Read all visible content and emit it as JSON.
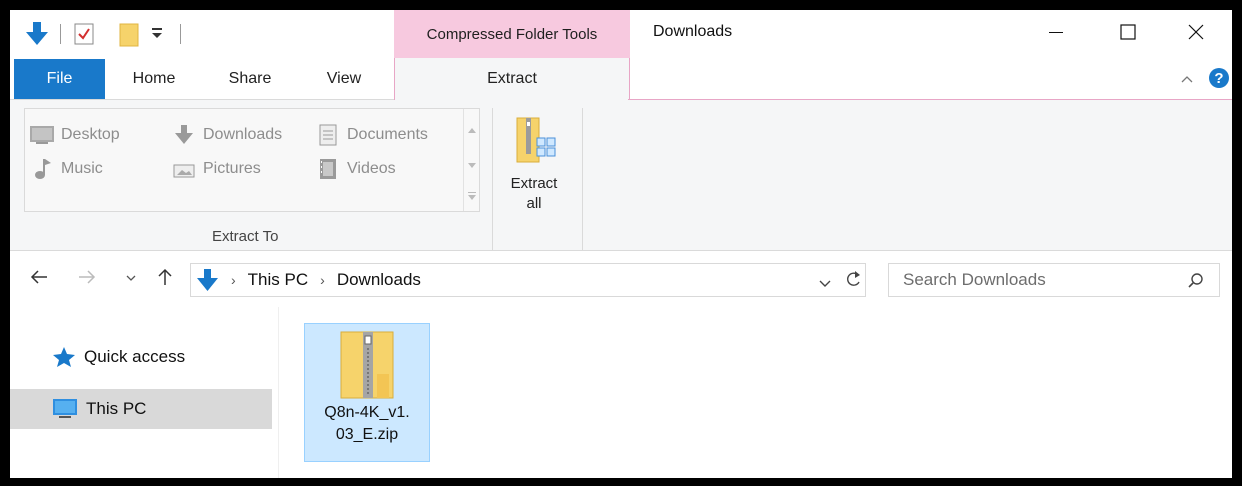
{
  "titlebar": {
    "contextual_tab": "Compressed Folder Tools",
    "window_title": "Downloads",
    "minimize_icon": "minimize-icon",
    "maximize_icon": "maximize-icon",
    "close_icon": "close-icon"
  },
  "ribbon_tabs": {
    "file": "File",
    "home": "Home",
    "share": "Share",
    "view": "View",
    "extract": "Extract"
  },
  "ribbon": {
    "extract_to_items": [
      {
        "label": "Desktop",
        "icon": "desktop-icon"
      },
      {
        "label": "Downloads",
        "icon": "downloads-arrow-icon"
      },
      {
        "label": "Documents",
        "icon": "documents-icon"
      },
      {
        "label": "Music",
        "icon": "music-icon"
      },
      {
        "label": "Pictures",
        "icon": "pictures-icon"
      },
      {
        "label": "Videos",
        "icon": "videos-icon"
      }
    ],
    "extract_to_label": "Extract To",
    "extract_all_line1": "Extract",
    "extract_all_line2": "all"
  },
  "address": {
    "crumbs": [
      "This PC",
      "Downloads"
    ],
    "search_placeholder": "Search Downloads"
  },
  "navpane": {
    "quick_access": "Quick access",
    "this_pc": "This PC"
  },
  "files": [
    {
      "name_line1": "Q8n-4K_v1.",
      "name_line2": "03_E.zip",
      "icon": "zip-folder-icon",
      "selected": true
    }
  ],
  "colors": {
    "file_tab": "#1979ca",
    "contextual": "#f7c9df",
    "selection": "#cce8ff",
    "folder": "#f6d36b"
  }
}
